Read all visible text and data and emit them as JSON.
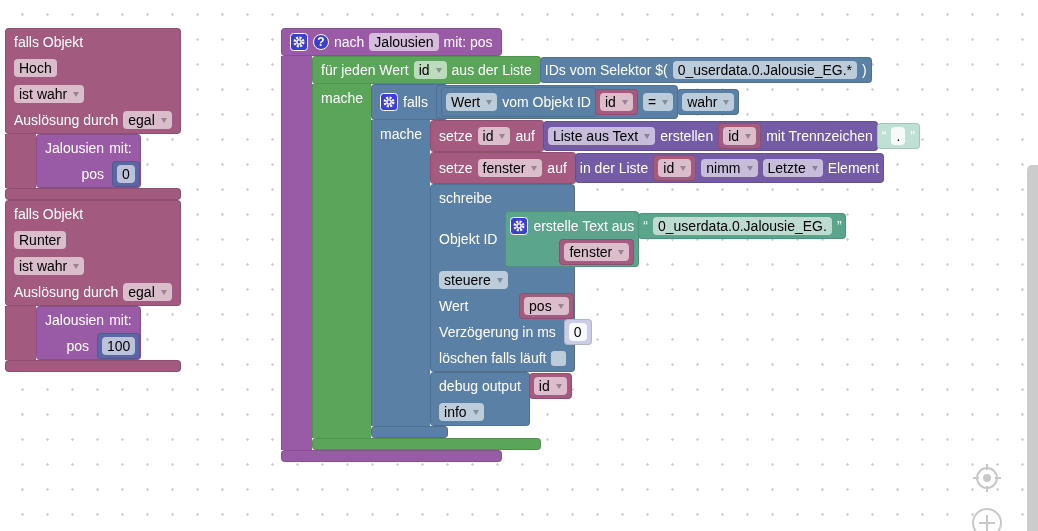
{
  "stacks": [
    {
      "blocks": [
        {
          "kind": "event",
          "rows": [
            {
              "parts": [
                {
                  "kind": "label",
                  "text": "falls Objekt"
                }
              ]
            },
            {
              "parts": [
                {
                  "kind": "field",
                  "text": "Hoch"
                }
              ]
            },
            {
              "parts": [
                {
                  "kind": "dropdown",
                  "text": "ist wahr"
                }
              ]
            },
            {
              "parts": [
                {
                  "kind": "label",
                  "text": "Auslösung durch"
                },
                {
                  "kind": "dropdown",
                  "text": "egal"
                }
              ]
            },
            {
              "statement": [
                {
                  "kind": "procedure",
                  "rows": [
                    {
                      "parts": [
                        {
                          "kind": "label",
                          "text": "Jalousien"
                        },
                        {
                          "kind": "label",
                          "text": "mit:"
                        }
                      ]
                    },
                    {
                      "kind": "arguments",
                      "parts": [
                        {
                          "kind": "label",
                          "text": "pos"
                        },
                        {
                          "kind": "input",
                          "block": {
                            "kind": "math",
                            "rows": [
                              {
                                "parts": [
                                  {
                                    "kind": "field",
                                    "text": "0"
                                  }
                                ]
                              }
                            ]
                          }
                        }
                      ]
                    }
                  ]
                }
              ]
            }
          ]
        },
        {
          "kind": "event",
          "rows": [
            {
              "parts": [
                {
                  "kind": "label",
                  "text": "falls Objekt"
                }
              ]
            },
            {
              "parts": [
                {
                  "kind": "field",
                  "text": "Runter"
                }
              ]
            },
            {
              "parts": [
                {
                  "kind": "dropdown",
                  "text": "ist wahr"
                }
              ]
            },
            {
              "parts": [
                {
                  "kind": "label",
                  "text": "Auslösung durch"
                },
                {
                  "kind": "dropdown",
                  "text": "egal"
                }
              ]
            },
            {
              "statement": [
                {
                  "kind": "procedure",
                  "rows": [
                    {
                      "parts": [
                        {
                          "kind": "label",
                          "text": "Jalousien"
                        },
                        {
                          "kind": "label",
                          "text": "mit:"
                        }
                      ]
                    },
                    {
                      "kind": "arguments",
                      "parts": [
                        {
                          "kind": "label",
                          "text": "pos"
                        },
                        {
                          "kind": "input",
                          "block": {
                            "kind": "math",
                            "rows": [
                              {
                                "parts": [
                                  {
                                    "kind": "field",
                                    "text": "100"
                                  }
                                ]
                              }
                            ]
                          }
                        }
                      ]
                    }
                  ]
                }
              ]
            }
          ]
        }
      ]
    },
    {
      "blocks": [
        {
          "kind": "procedure",
          "rows": [
            {
              "parts": [
                {
                  "kind": "mutator"
                },
                {
                  "kind": "help",
                  "text": "?"
                },
                {
                  "kind": "label",
                  "text": "nach"
                },
                {
                  "kind": "field",
                  "text": "Jalousien"
                },
                {
                  "kind": "label",
                  "text": "mit: pos"
                }
              ]
            },
            {
              "statement": [
                {
                  "kind": "loop",
                  "rows": [
                    {
                      "parts": [
                        {
                          "kind": "label",
                          "text": "für jeden Wert"
                        },
                        {
                          "kind": "dropdown",
                          "text": "id"
                        },
                        {
                          "kind": "label",
                          "text": "aus der Liste"
                        },
                        {
                          "kind": "input",
                          "block": {
                            "kind": "command",
                            "rows": [
                              {
                                "parts": [
                                  {
                                    "kind": "label",
                                    "text": "IDs vom Selektor $("
                                  },
                                  {
                                    "kind": "field",
                                    "text": "0_userdata.0.Jalousie_EG.*"
                                  },
                                  {
                                    "kind": "label",
                                    "text": ")"
                                  }
                                ]
                              }
                            ]
                          }
                        }
                      ]
                    },
                    {
                      "label": "mache",
                      "statement": [
                        {
                          "kind": "command",
                          "rows": [
                            {
                              "parts": [
                                {
                                  "kind": "mutator"
                                },
                                {
                                  "kind": "label",
                                  "text": "falls"
                                },
                                {
                                  "kind": "input",
                                  "block": {
                                    "kind": "command",
                                    "rows": [
                                      {
                                        "parts": [
                                          {
                                            "kind": "input",
                                            "block": {
                                              "kind": "command",
                                              "rows": [
                                                {
                                                  "parts": [
                                                    {
                                                      "kind": "dropdown",
                                                      "text": "Wert"
                                                    },
                                                    {
                                                      "kind": "label",
                                                      "text": "vom Objekt ID"
                                                    },
                                                    {
                                                      "kind": "input",
                                                      "block": {
                                                        "kind": "variable",
                                                        "rows": [
                                                          {
                                                            "parts": [
                                                              {
                                                                "kind": "dropdown",
                                                                "text": "id"
                                                              }
                                                            ]
                                                          }
                                                        ]
                                                      }
                                                    }
                                                  ]
                                                }
                                              ]
                                            }
                                          },
                                          {
                                            "kind": "dropdown",
                                            "text": "="
                                          },
                                          {
                                            "kind": "input",
                                            "block": {
                                              "kind": "command",
                                              "rows": [
                                                {
                                                  "parts": [
                                                    {
                                                      "kind": "dropdown",
                                                      "text": "wahr"
                                                    }
                                                  ]
                                                }
                                              ]
                                            }
                                          }
                                        ]
                                      }
                                    ]
                                  }
                                }
                              ]
                            },
                            {
                              "label": "mache",
                              "statement": [
                                {
                                  "kind": "variable",
                                  "rows": [
                                    {
                                      "parts": [
                                        {
                                          "kind": "label",
                                          "text": "setze"
                                        },
                                        {
                                          "kind": "dropdown",
                                          "text": "id"
                                        },
                                        {
                                          "kind": "label",
                                          "text": "auf"
                                        },
                                        {
                                          "kind": "input",
                                          "block": {
                                            "kind": "list",
                                            "rows": [
                                              {
                                                "parts": [
                                                  {
                                                    "kind": "dropdown",
                                                    "text": "Liste aus Text"
                                                  },
                                                  {
                                                    "kind": "label",
                                                    "text": "erstellen"
                                                  },
                                                  {
                                                    "kind": "input",
                                                    "block": {
                                                      "kind": "variable",
                                                      "rows": [
                                                        {
                                                          "parts": [
                                                            {
                                                              "kind": "dropdown",
                                                              "text": "id"
                                                            }
                                                          ]
                                                        }
                                                      ]
                                                    }
                                                  },
                                                  {
                                                    "kind": "label",
                                                    "text": "mit Trennzeichen"
                                                  },
                                                  {
                                                    "kind": "input",
                                                    "block": {
                                                      "kind": "text_shadow",
                                                      "rows": [
                                                        {
                                                          "parts": [
                                                            {
                                                              "kind": "label",
                                                              "text": "“"
                                                            },
                                                            {
                                                              "kind": "field",
                                                              "text": "."
                                                            },
                                                            {
                                                              "kind": "label",
                                                              "text": "”"
                                                            }
                                                          ]
                                                        }
                                                      ]
                                                    }
                                                  }
                                                ]
                                              }
                                            ]
                                          }
                                        }
                                      ]
                                    }
                                  ]
                                },
                                {
                                  "kind": "variable",
                                  "rows": [
                                    {
                                      "parts": [
                                        {
                                          "kind": "label",
                                          "text": "setze"
                                        },
                                        {
                                          "kind": "dropdown",
                                          "text": "fenster"
                                        },
                                        {
                                          "kind": "label",
                                          "text": "auf"
                                        },
                                        {
                                          "kind": "input",
                                          "block": {
                                            "kind": "list",
                                            "rows": [
                                              {
                                                "parts": [
                                                  {
                                                    "kind": "label",
                                                    "text": "in der Liste"
                                                  },
                                                  {
                                                    "kind": "input",
                                                    "block": {
                                                      "kind": "variable",
                                                      "rows": [
                                                        {
                                                          "parts": [
                                                            {
                                                              "kind": "dropdown",
                                                              "text": "id"
                                                            }
                                                          ]
                                                        }
                                                      ]
                                                    }
                                                  },
                                                  {
                                                    "kind": "dropdown",
                                                    "text": "nimm"
                                                  },
                                                  {
                                                    "kind": "dropdown",
                                                    "text": "Letzte"
                                                  },
                                                  {
                                                    "kind": "label",
                                                    "text": "Element"
                                                  }
                                                ]
                                              }
                                            ]
                                          }
                                        }
                                      ]
                                    }
                                  ]
                                },
                                {
                                  "kind": "command",
                                  "rows": [
                                    {
                                      "parts": [
                                        {
                                          "kind": "label",
                                          "text": "schreibe"
                                        }
                                      ]
                                    },
                                    {
                                      "parts": [
                                        {
                                          "kind": "label",
                                          "text": "Objekt ID"
                                        },
                                        {
                                          "kind": "input",
                                          "block": {
                                            "kind": "text",
                                            "rows": [
                                              {
                                                "parts": [
                                                  {
                                                    "kind": "mutator"
                                                  },
                                                  {
                                                    "kind": "label",
                                                    "text": "erstelle Text aus"
                                                  },
                                                  {
                                                    "kind": "input",
                                                    "block": {
                                                      "kind": "text",
                                                      "rows": [
                                                        {
                                                          "parts": [
                                                            {
                                                              "kind": "label",
                                                              "text": "“"
                                                            },
                                                            {
                                                              "kind": "field",
                                                              "text": "0_userdata.0.Jalousie_EG."
                                                            },
                                                            {
                                                              "kind": "label",
                                                              "text": "”"
                                                            }
                                                          ]
                                                        }
                                                      ]
                                                    }
                                                  }
                                                ]
                                              },
                                              {
                                                "parts": [
                                                  {
                                                    "kind": "input",
                                                    "block": {
                                                      "kind": "variable",
                                                      "rows": [
                                                        {
                                                          "parts": [
                                                            {
                                                              "kind": "dropdown",
                                                              "text": "fenster"
                                                            }
                                                          ]
                                                        }
                                                      ]
                                                    }
                                                  }
                                                ]
                                              }
                                            ]
                                          }
                                        }
                                      ]
                                    },
                                    {
                                      "parts": [
                                        {
                                          "kind": "dropdown",
                                          "text": "steuere"
                                        }
                                      ]
                                    },
                                    {
                                      "parts": [
                                        {
                                          "kind": "label",
                                          "text": "Wert"
                                        },
                                        {
                                          "kind": "input",
                                          "block": {
                                            "kind": "variable",
                                            "rows": [
                                              {
                                                "parts": [
                                                  {
                                                    "kind": "dropdown",
                                                    "text": "pos"
                                                  }
                                                ]
                                              }
                                            ]
                                          }
                                        }
                                      ]
                                    },
                                    {
                                      "parts": [
                                        {
                                          "kind": "label",
                                          "text": "Verzögerung in ms"
                                        },
                                        {
                                          "kind": "input",
                                          "block": {
                                            "kind": "math_shadow",
                                            "rows": [
                                              {
                                                "parts": [
                                                  {
                                                    "kind": "field",
                                                    "text": "0"
                                                  }
                                                ]
                                              }
                                            ]
                                          }
                                        }
                                      ]
                                    },
                                    {
                                      "parts": [
                                        {
                                          "kind": "label",
                                          "text": "löschen falls läuft"
                                        },
                                        {
                                          "kind": "checkbox",
                                          "checked": false
                                        }
                                      ]
                                    }
                                  ]
                                },
                                {
                                  "kind": "command",
                                  "rows": [
                                    {
                                      "parts": [
                                        {
                                          "kind": "label",
                                          "text": "debug output"
                                        },
                                        {
                                          "kind": "input",
                                          "block": {
                                            "kind": "variable",
                                            "rows": [
                                              {
                                                "parts": [
                                                  {
                                                    "kind": "dropdown",
                                                    "text": "id"
                                                  }
                                                ]
                                              }
                                            ]
                                          }
                                        }
                                      ]
                                    },
                                    {
                                      "parts": [
                                        {
                                          "kind": "dropdown",
                                          "text": "info"
                                        }
                                      ]
                                    }
                                  ]
                                }
                              ]
                            }
                          ]
                        }
                      ]
                    }
                  ]
                }
              ]
            }
          ]
        }
      ]
    }
  ]
}
